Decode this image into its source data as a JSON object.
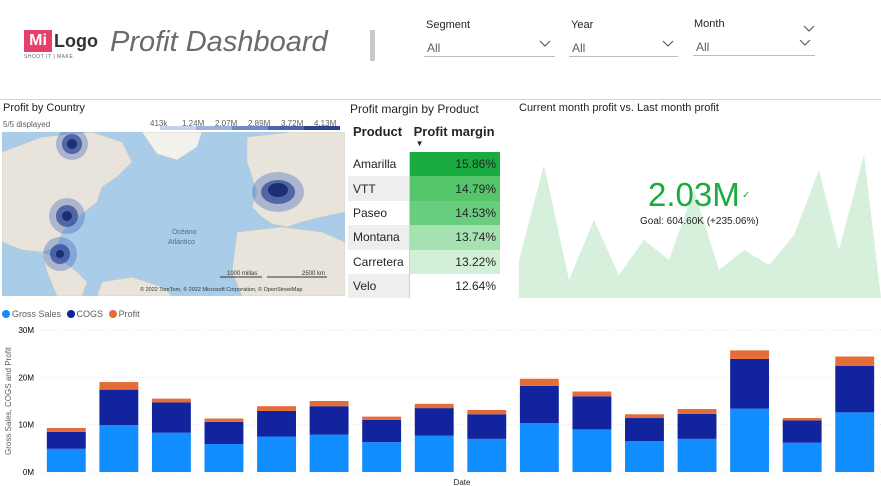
{
  "header": {
    "logo_mark": "Mi",
    "logo_word": "Logo",
    "logo_tagline": "SHOOT IT | MAKE",
    "title": "Profit Dashboard"
  },
  "slicers": [
    {
      "label": "Segment",
      "value": "All"
    },
    {
      "label": "Year",
      "value": "All"
    },
    {
      "label": "Month",
      "value": "All"
    }
  ],
  "map": {
    "title": "Profit by Country",
    "displayed": "5/5 displayed",
    "legend_ticks": [
      "413k",
      "1.24M",
      "2.07M",
      "2.89M",
      "3.72M",
      "4.13M"
    ],
    "ocean_label_1": "Océano",
    "ocean_label_2": "Atlántico",
    "scale_1": "1000 millas",
    "scale_2": "2500 km",
    "attribution": "© 2022 TomTom, © 2022 Microsoft Corporation, © OpenStreetMap"
  },
  "profit_margin": {
    "title": "Profit margin by Product",
    "col_product": "Product",
    "col_margin": "Profit margin",
    "rows": [
      {
        "product": "Amarilla",
        "margin": "15.86%"
      },
      {
        "product": "VTT",
        "margin": "14.79%"
      },
      {
        "product": "Paseo",
        "margin": "14.53%"
      },
      {
        "product": "Montana",
        "margin": "13.74%"
      },
      {
        "product": "Carretera",
        "margin": "13.22%"
      },
      {
        "product": "Velo",
        "margin": "12.64%"
      }
    ],
    "shade_colors": [
      "#1aab40",
      "#54c56b",
      "#69cd7e",
      "#a6e1b1",
      "#d1f0d7",
      "#ffffff"
    ]
  },
  "kpi": {
    "title": "Current month profit vs. Last month profit",
    "value": "2.03M",
    "goal": "Goal: 604.60K (+235.06%)",
    "accent": "#1aab40",
    "trend_fill": "#d6f0dc"
  },
  "chart_data": {
    "type": "bar",
    "stacked": true,
    "title": "",
    "xlabel": "Date",
    "ylabel": "Gross Sales, COGS and Profit",
    "ylim": [
      0,
      30000000
    ],
    "yticks": [
      "0M",
      "10M",
      "20M",
      "30M"
    ],
    "series": [
      {
        "name": "Gross Sales",
        "color": "#118dff",
        "values": [
          4.9,
          9.9,
          8.3,
          5.9,
          7.5,
          7.9,
          6.3,
          7.7,
          7.0,
          10.3,
          9.0,
          6.5,
          7.0,
          13.4,
          6.2,
          12.6
        ]
      },
      {
        "name": "COGS",
        "color": "#12239e",
        "values": [
          3.6,
          7.5,
          6.4,
          4.7,
          5.4,
          6.0,
          4.7,
          5.8,
          5.2,
          7.9,
          7.0,
          4.9,
          5.3,
          10.5,
          4.7,
          9.8
        ]
      },
      {
        "name": "Profit",
        "color": "#e66c37",
        "values": [
          0.8,
          1.6,
          0.8,
          0.7,
          1.0,
          1.1,
          0.7,
          0.9,
          0.9,
          1.5,
          1.0,
          0.8,
          1.0,
          1.8,
          0.5,
          2.0
        ]
      }
    ],
    "legend": "top-left",
    "grid": true
  }
}
